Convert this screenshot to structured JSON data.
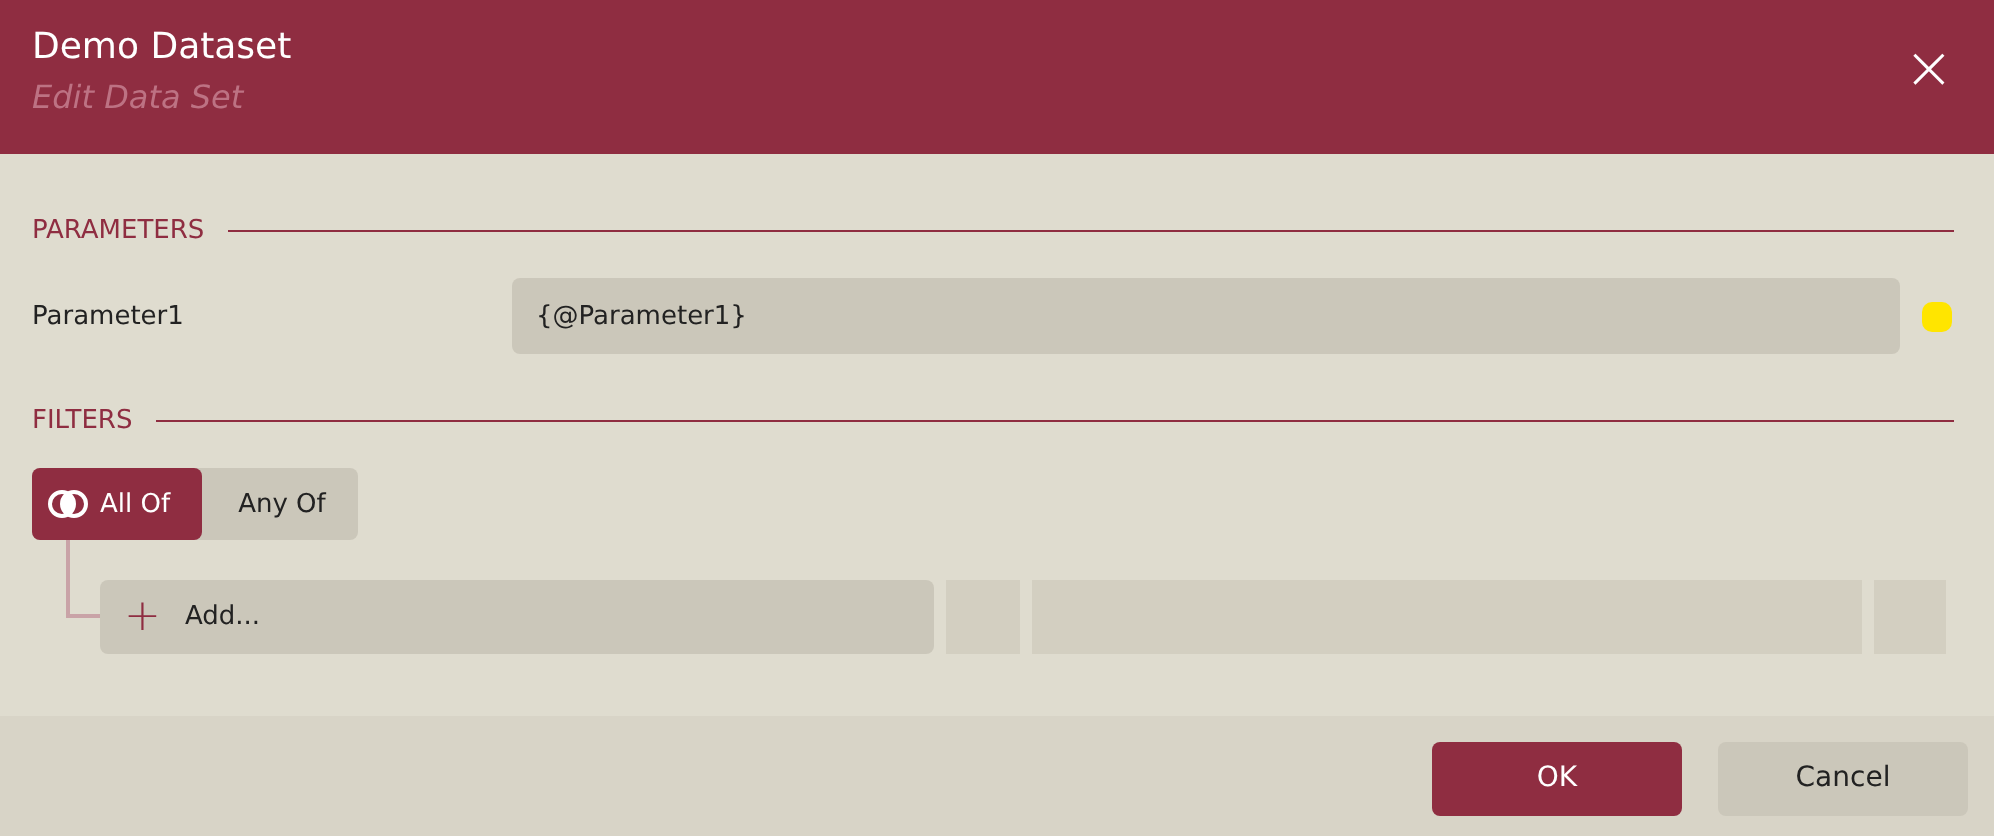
{
  "window": {
    "title": "Demo Dataset",
    "subtitle": "Edit Data Set",
    "close": "×"
  },
  "parameters_section": {
    "heading": "PARAMETERS",
    "items": [
      {
        "label": "Parameter1",
        "value": "{@Parameter1}",
        "color": "#ffe500"
      }
    ]
  },
  "filters_section": {
    "heading": "FILTERS",
    "modes": [
      {
        "label": "All Of",
        "selected": true
      },
      {
        "label": "Any Of",
        "selected": false
      }
    ],
    "add_label": "Add...",
    "add_icon": "+"
  },
  "buttons": [
    {
      "label": "OK",
      "kind": "primary"
    },
    {
      "label": "Cancel",
      "kind": "secondary"
    }
  ]
}
